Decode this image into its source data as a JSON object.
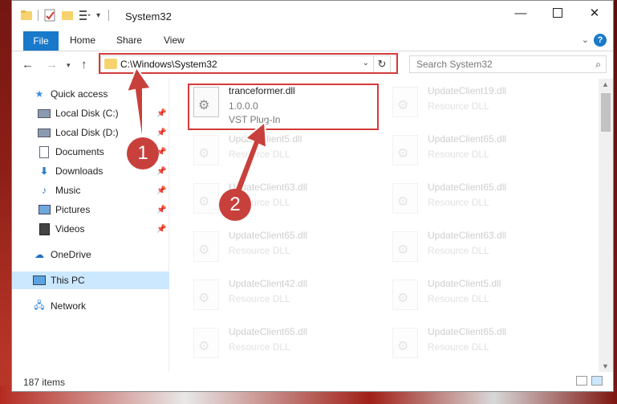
{
  "window": {
    "title": "System32"
  },
  "ribbon": {
    "tabs": [
      "File",
      "Home",
      "Share",
      "View"
    ],
    "help": "?"
  },
  "navigation": {
    "address": "C:\\Windows\\System32",
    "search_placeholder": "Search System32"
  },
  "sidebar": {
    "items": [
      {
        "label": "Quick access",
        "icon": "star-icon"
      },
      {
        "label": "Local Disk (C:)",
        "icon": "drive-icon"
      },
      {
        "label": "Local Disk (D:)",
        "icon": "drive-icon"
      },
      {
        "label": "Documents",
        "icon": "documents-icon"
      },
      {
        "label": "Downloads",
        "icon": "download-icon"
      },
      {
        "label": "Music",
        "icon": "music-icon"
      },
      {
        "label": "Pictures",
        "icon": "pictures-icon"
      },
      {
        "label": "Videos",
        "icon": "videos-icon"
      },
      {
        "label": "OneDrive",
        "icon": "cloud-icon"
      },
      {
        "label": "This PC",
        "icon": "computer-icon"
      },
      {
        "label": "Network",
        "icon": "network-icon"
      }
    ]
  },
  "files": {
    "highlighted": {
      "name": "tranceformer.dll",
      "version": "1.0.0.0",
      "type": "VST Plug-In"
    },
    "left_column": [
      {
        "name": "UpdateClient5.dll",
        "type": "Resource DLL"
      },
      {
        "name": "UpdateClient63.dll",
        "type": "Resource DLL"
      },
      {
        "name": "UpdateClient65.dll",
        "type": "Resource DLL"
      },
      {
        "name": "UpdateClient42.dll",
        "type": "Resource DLL"
      },
      {
        "name": "UpdateClient65.dll",
        "type": "Resource DLL"
      }
    ],
    "right_column": [
      {
        "name": "UpdateClient19.dll",
        "type": "Resource DLL"
      },
      {
        "name": "UpdateClient65.dll",
        "type": "Resource DLL"
      },
      {
        "name": "UpdateClient65.dll",
        "type": "Resource DLL"
      },
      {
        "name": "UpdateClient63.dll",
        "type": "Resource DLL"
      },
      {
        "name": "UpdateClient5.dll",
        "type": "Resource DLL"
      },
      {
        "name": "UpdateClient65.dll",
        "type": "Resource DLL"
      }
    ]
  },
  "status": {
    "item_count": "187 items"
  },
  "annotations": {
    "step1": "1",
    "step2": "2",
    "color": "#d43a3a"
  }
}
